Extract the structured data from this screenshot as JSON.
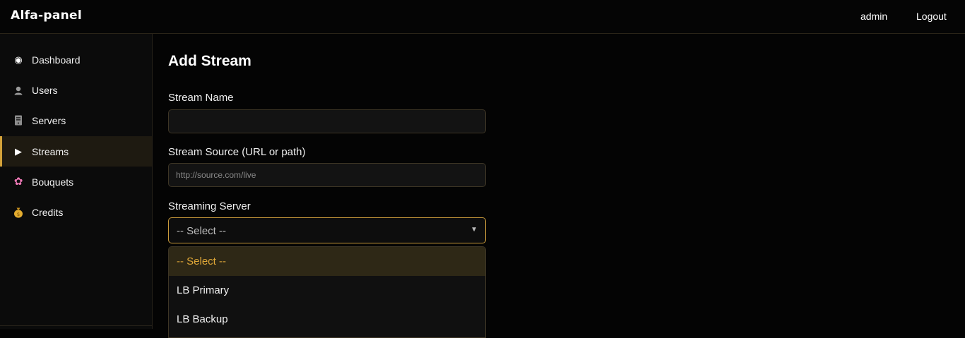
{
  "app": {
    "brand": "Alfa-panel"
  },
  "topbar": {
    "user": "admin",
    "logout": "Logout"
  },
  "sidebar": {
    "items": [
      {
        "label": "Dashboard",
        "icon": "radio-dot-icon",
        "glyph": "◉",
        "color": "#ffffff",
        "active": false
      },
      {
        "label": "Users",
        "icon": "user-icon",
        "glyph": "👤",
        "color": "#bbbbbb",
        "active": false
      },
      {
        "label": "Servers",
        "icon": "server-icon",
        "glyph": "🖥",
        "color": "#bbbbbb",
        "active": false
      },
      {
        "label": "Streams",
        "icon": "play-icon",
        "glyph": "▶",
        "color": "#ffffff",
        "active": true
      },
      {
        "label": "Bouquets",
        "icon": "flower-icon",
        "glyph": "✿",
        "color": "#f07ab8",
        "active": false
      },
      {
        "label": "Credits",
        "icon": "money-bag-icon",
        "glyph": "💰",
        "color": "#e0b03a",
        "active": false
      }
    ]
  },
  "main": {
    "title": "Add Stream",
    "stream_name": {
      "label": "Stream Name",
      "value": "",
      "placeholder": ""
    },
    "stream_source": {
      "label": "Stream Source (URL or path)",
      "value": "",
      "placeholder": "http://source.com/live"
    },
    "streaming_server": {
      "label": "Streaming Server",
      "selected": "-- Select --",
      "options": [
        "-- Select --",
        "LB Primary",
        "LB Backup"
      ]
    }
  },
  "colors": {
    "accent": "#d4a23a",
    "background": "#040404",
    "sidebar": "#0b0b0b"
  }
}
